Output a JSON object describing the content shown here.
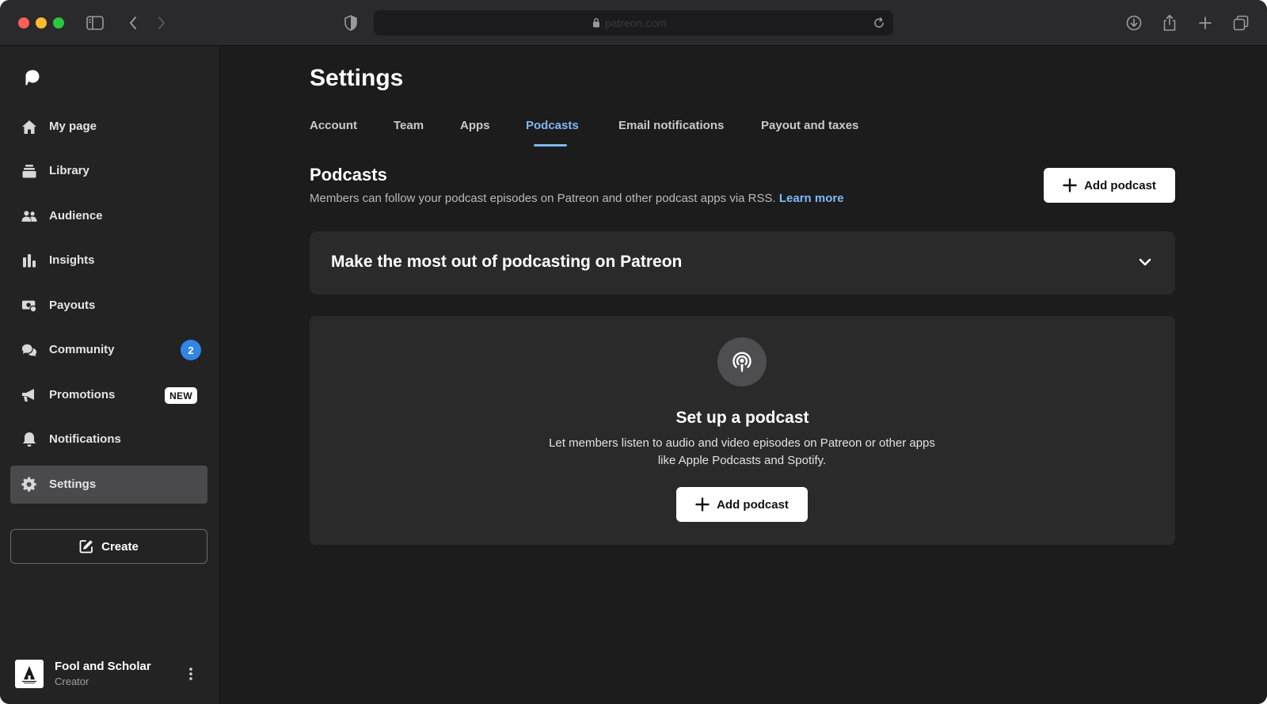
{
  "browser": {
    "url": "patreon.com"
  },
  "sidebar": {
    "items": [
      {
        "label": "My page",
        "icon": "home-icon"
      },
      {
        "label": "Library",
        "icon": "library-icon"
      },
      {
        "label": "Audience",
        "icon": "audience-icon"
      },
      {
        "label": "Insights",
        "icon": "insights-icon"
      },
      {
        "label": "Payouts",
        "icon": "payouts-icon"
      },
      {
        "label": "Community",
        "icon": "community-icon",
        "badge": "2"
      },
      {
        "label": "Promotions",
        "icon": "promotions-icon",
        "badge": "NEW"
      },
      {
        "label": "Notifications",
        "icon": "notifications-icon"
      },
      {
        "label": "Settings",
        "icon": "settings-icon",
        "active": true
      }
    ],
    "create_label": "Create",
    "profile": {
      "name": "Fool and Scholar",
      "role": "Creator"
    }
  },
  "main": {
    "title": "Settings",
    "tabs": [
      {
        "label": "Account"
      },
      {
        "label": "Team"
      },
      {
        "label": "Apps"
      },
      {
        "label": "Podcasts",
        "active": true
      },
      {
        "label": "Email notifications"
      },
      {
        "label": "Payout and taxes"
      }
    ],
    "section": {
      "title": "Podcasts",
      "description": "Members can follow your podcast episodes on Patreon and other podcast apps via RSS.",
      "learn_more": "Learn more",
      "add_button": "Add podcast"
    },
    "accordion": {
      "title": "Make the most out of podcasting on Patreon"
    },
    "empty_state": {
      "title": "Set up a podcast",
      "description": "Let members listen to audio and video episodes on Patreon or other apps like Apple Podcasts and Spotify.",
      "add_button": "Add podcast"
    }
  },
  "colors": {
    "accent": "#7fb8f5",
    "badge_blue": "#2f86e6",
    "background": "#1c1c1d",
    "sidebar": "#232324"
  }
}
